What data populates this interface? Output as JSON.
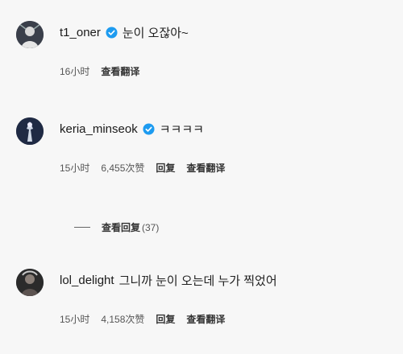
{
  "comments": [
    {
      "username": "t1_oner",
      "verified": true,
      "text": "눈이 오잖아~",
      "time": "16小时",
      "likes": "",
      "reply_label": "",
      "translate_label": "查看翻译"
    },
    {
      "username": "keria_minseok",
      "verified": true,
      "text": "ㅋㅋㅋㅋ",
      "time": "15小时",
      "likes": "6,455次赞",
      "reply_label": "回复",
      "translate_label": "查看翻译"
    },
    {
      "username": "lol_delight",
      "verified": false,
      "text": "그니까 눈이 오는데 누가 찍었어",
      "time": "15小时",
      "likes": "4,158次赞",
      "reply_label": "回复",
      "translate_label": "查看翻译"
    }
  ],
  "view_replies": {
    "label": "查看回复",
    "count": "(37)"
  },
  "colors": {
    "verified_blue": "#1d9bf0",
    "background": "#f7f7f7"
  }
}
